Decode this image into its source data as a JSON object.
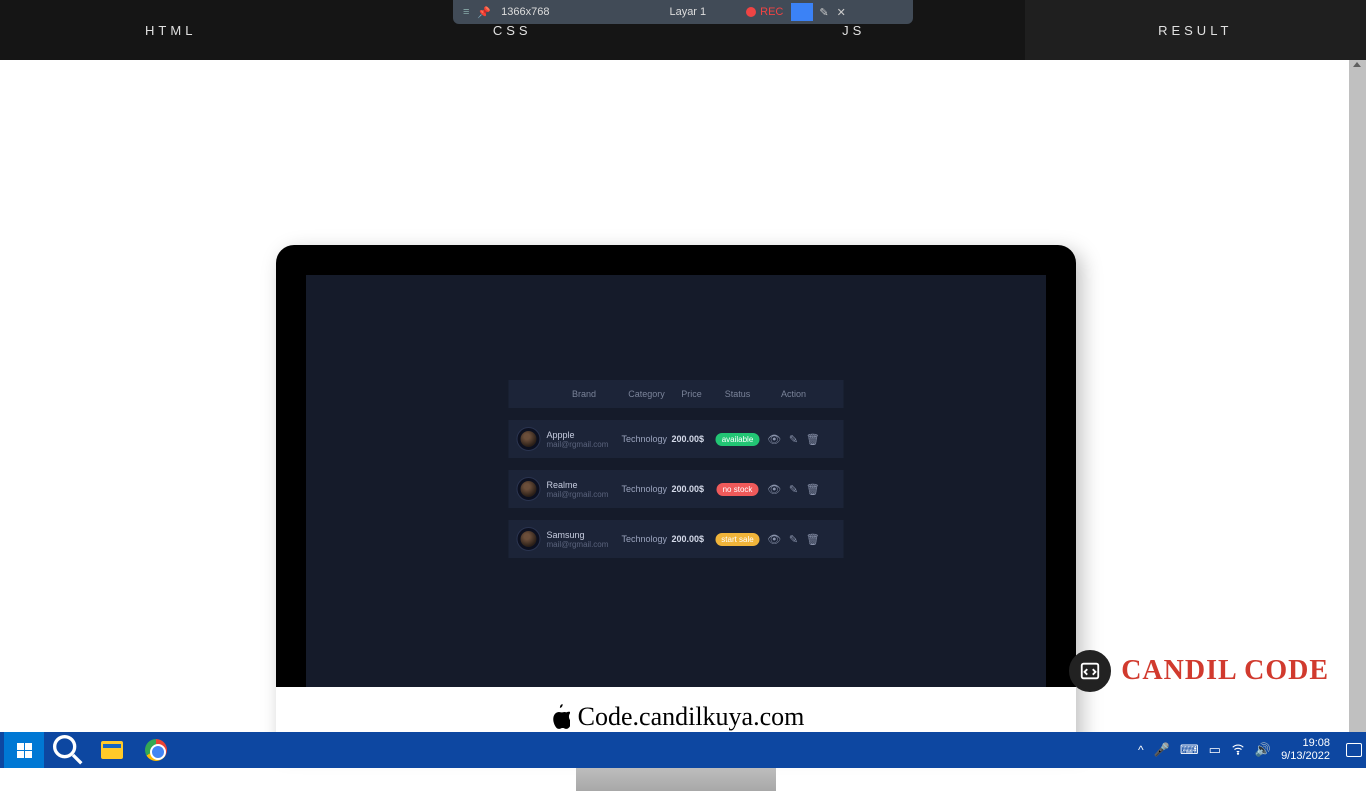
{
  "recorder": {
    "dimensions": "1366x768",
    "layer": "Layar 1",
    "rec": "REC"
  },
  "tabs": {
    "html": "HTML",
    "css": "CSS",
    "js": "JS",
    "result": "RESULT"
  },
  "imac": {
    "label": "Code.candilkuya.com"
  },
  "table": {
    "headers": {
      "brand": "Brand",
      "category": "Category",
      "price": "Price",
      "status": "Status",
      "action": "Action"
    },
    "rows": [
      {
        "brand": "Appple",
        "mail": "mail@rgmail.com",
        "category": "Technology",
        "price": "200.00$",
        "status": "available",
        "statusClass": "available"
      },
      {
        "brand": "Realme",
        "mail": "mail@rgmail.com",
        "category": "Technology",
        "price": "200.00$",
        "status": "no stock",
        "statusClass": "nostock"
      },
      {
        "brand": "Samsung",
        "mail": "mail@rgmail.com",
        "category": "Technology",
        "price": "200.00$",
        "status": "start sale",
        "statusClass": "startsale"
      }
    ]
  },
  "watermark": {
    "text": "CANDIL CODE"
  },
  "taskbar": {
    "time": "19:08",
    "date": "9/13/2022"
  }
}
